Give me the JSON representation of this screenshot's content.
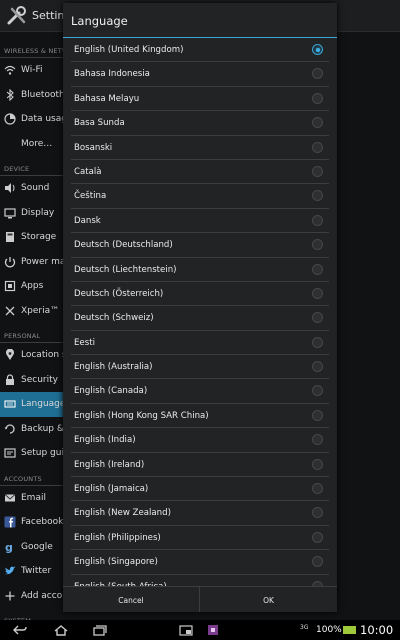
{
  "settings": {
    "title": "Settings",
    "sections": [
      {
        "header": "Wireless & networks",
        "items": [
          {
            "label": "Wi-Fi",
            "icon": "wifi-icon"
          },
          {
            "label": "Bluetooth",
            "icon": "bluetooth-icon"
          },
          {
            "label": "Data usage",
            "icon": "data-usage-icon"
          },
          {
            "label": "More…",
            "icon": ""
          }
        ]
      },
      {
        "header": "Device",
        "items": [
          {
            "label": "Sound",
            "icon": "sound-icon"
          },
          {
            "label": "Display",
            "icon": "display-icon"
          },
          {
            "label": "Storage",
            "icon": "storage-icon"
          },
          {
            "label": "Power management",
            "icon": "power-icon"
          },
          {
            "label": "Apps",
            "icon": "apps-icon"
          },
          {
            "label": "Xperia™",
            "icon": "xperia-icon"
          }
        ]
      },
      {
        "header": "Personal",
        "items": [
          {
            "label": "Location services",
            "icon": "location-icon"
          },
          {
            "label": "Security",
            "icon": "lock-icon"
          },
          {
            "label": "Language & input",
            "icon": "keyboard-icon",
            "active": true
          },
          {
            "label": "Backup & reset",
            "icon": "backup-icon"
          },
          {
            "label": "Setup guide",
            "icon": "setup-guide-icon"
          }
        ]
      },
      {
        "header": "Accounts",
        "items": [
          {
            "label": "Email",
            "icon": "email-icon"
          },
          {
            "label": "Facebook",
            "icon": "facebook-icon"
          },
          {
            "label": "Google",
            "icon": "google-icon"
          },
          {
            "label": "Twitter",
            "icon": "twitter-icon"
          },
          {
            "label": "Add account",
            "icon": "add-icon"
          }
        ]
      },
      {
        "header": "System",
        "items": []
      }
    ]
  },
  "dialog": {
    "title": "Language",
    "languages": [
      "English (United Kingdom)",
      "Bahasa Indonesia",
      "Bahasa Melayu",
      "Basa Sunda",
      "Bosanski",
      "Català",
      "Čeština",
      "Dansk",
      "Deutsch (Deutschland)",
      "Deutsch (Liechtenstein)",
      "Deutsch (Österreich)",
      "Deutsch (Schweiz)",
      "Eesti",
      "English (Australia)",
      "English (Canada)",
      "English (Hong Kong SAR China)",
      "English (India)",
      "English (Ireland)",
      "English (Jamaica)",
      "English (New Zealand)",
      "English (Philippines)",
      "English (Singapore)",
      "English (South Africa)"
    ],
    "selected_index": 0,
    "cancel_label": "Cancel",
    "ok_label": "OK"
  },
  "statusbar": {
    "signal": "3G",
    "battery": "100%",
    "time": "10:00"
  },
  "colors": {
    "accent": "#3aa6d6",
    "active_item": "#1f6e93",
    "battery": "#9ec93a"
  }
}
